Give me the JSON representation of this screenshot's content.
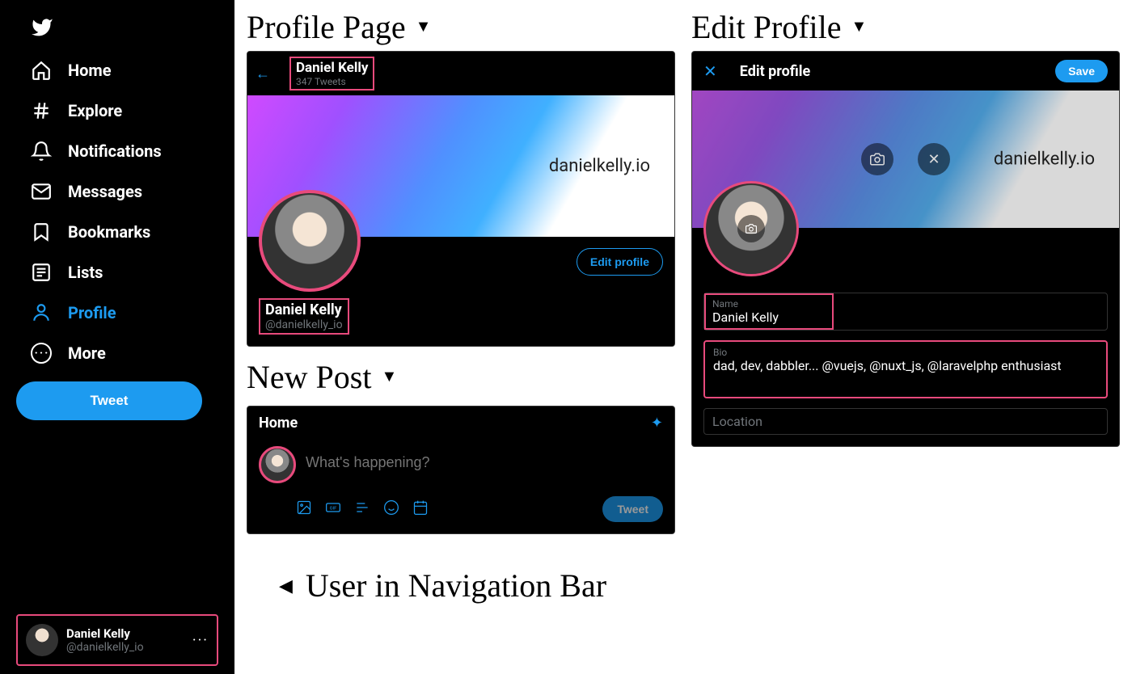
{
  "sidebar": {
    "items": [
      {
        "label": "Home"
      },
      {
        "label": "Explore"
      },
      {
        "label": "Notifications"
      },
      {
        "label": "Messages"
      },
      {
        "label": "Bookmarks"
      },
      {
        "label": "Lists"
      },
      {
        "label": "Profile"
      },
      {
        "label": "More"
      }
    ],
    "tweet_button": "Tweet",
    "user": {
      "name": "Daniel Kelly",
      "handle": "@danielkelly_io"
    }
  },
  "titles": {
    "profile_page": "Profile Page",
    "new_post": "New Post",
    "edit_profile": "Edit Profile",
    "user_in_nav": "User in Navigation Bar"
  },
  "profile": {
    "name": "Daniel Kelly",
    "tweet_count": "347 Tweets",
    "banner_text": "danielkelly.io",
    "display_name": "Daniel Kelly",
    "handle": "@danielkelly_io",
    "edit_button": "Edit profile"
  },
  "compose": {
    "header": "Home",
    "placeholder": "What's happening?",
    "tweet_button": "Tweet"
  },
  "edit": {
    "title": "Edit profile",
    "save": "Save",
    "banner_text": "danielkelly.io",
    "name_label": "Name",
    "name_value": "Daniel Kelly",
    "bio_label": "Bio",
    "bio_value": "dad, dev, dabbler... @vuejs, @nuxt_js, @laravelphp enthusiast",
    "location_placeholder": "Location"
  }
}
